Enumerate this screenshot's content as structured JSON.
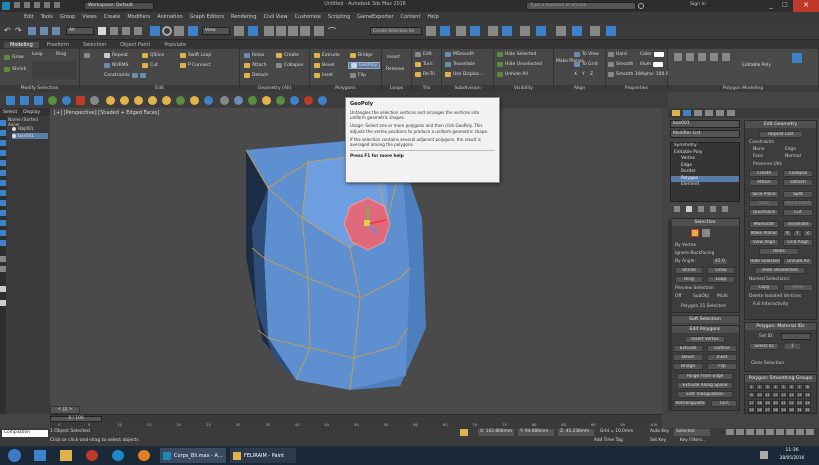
{
  "titlebar": {
    "workspace": "Workspace: Default",
    "title": "Untitled - Autodesk 3ds Max 2016",
    "search_placeholder": "Type a keyword or phrase",
    "sign_in": "Sign In"
  },
  "menu": [
    "Edit",
    "Tools",
    "Group",
    "Views",
    "Create",
    "Modifiers",
    "Animation",
    "Graph Editors",
    "Rendering",
    "Civil View",
    "Customize",
    "Scripting",
    "GameExporter",
    "Content",
    "Help"
  ],
  "toolbar": {
    "filter": "All",
    "view": "View",
    "selection_set": "Create Selection Se"
  },
  "ribbon_tabs": [
    {
      "label": "Modeling",
      "active": true
    },
    {
      "label": "Freeform",
      "active": false
    },
    {
      "label": "Selection",
      "active": false
    },
    {
      "label": "Object Paint",
      "active": false
    },
    {
      "label": "Populate",
      "active": false
    }
  ],
  "ribbon": {
    "polygon_modeling": {
      "title": "Polygon Modeling",
      "buttons": [
        "Grow",
        "Shrink"
      ],
      "loop": "Loop",
      "ring": "Ring",
      "modify_selection": "Modify Selection"
    },
    "edit": {
      "title": "Edit",
      "buttons": [
        "Repeat",
        "QSlice",
        "Swift Loop",
        "NURMS",
        "Cut",
        "P Connect",
        "Constraints"
      ]
    },
    "geometry": {
      "title": "Geometry (All)",
      "buttons": [
        "Relax",
        "Create",
        "Attach",
        "Collapse",
        "Detach"
      ]
    },
    "polygons": {
      "title": "Polygons",
      "buttons": [
        "Extrude",
        "Bridge",
        "Bevel",
        "GeoPoly",
        "Inset",
        "Flip"
      ]
    },
    "loops": {
      "title": "Loops",
      "buttons": [
        "Insert",
        "Remove"
      ]
    },
    "tris": {
      "title": "Tris",
      "buttons": [
        "Edit",
        "Turn",
        "Re-Tri"
      ]
    },
    "subdivision": {
      "title": "Subdivision",
      "buttons": [
        "MSmooth",
        "Tessellate",
        "Use Displac..."
      ]
    },
    "visibility": {
      "title": "Visibility",
      "buttons": [
        "Hide Selected",
        "Hide Unselected",
        "Unhide All"
      ]
    },
    "align": {
      "title": "Align",
      "buttons": [
        "Make Planar",
        "To View",
        "To Grid",
        "X",
        "Y",
        "Z"
      ]
    },
    "properties": {
      "title": "Properties",
      "buttons": [
        "Hard",
        "Smooth",
        "Smooth 30",
        "Color",
        "Illum",
        "Alpha: 100.00"
      ]
    },
    "editable_poly": "Editable Poly"
  },
  "left_panel": {
    "tabs": [
      "Select",
      "Display"
    ],
    "header": "Name (Sorted Ascer",
    "items": [
      "Obj001",
      "box001"
    ]
  },
  "viewport": {
    "label": "[+] [Perspective] [Shaded + Edged Faces]"
  },
  "tooltip": {
    "title": "GeoPoly",
    "p1": "Untangles the selection vertices and arranges the vertices into uniform geometric shapes.",
    "p2": "Usage: Select one or more polygons and then click GeoPoly. This adjusts the vertex positions to produce a uniform geometric shape.",
    "p3": "If the selection contains several adjacent polygons, the result is averaged among the polygons.",
    "footer": "Press F1 for more help"
  },
  "command_panel": {
    "object_name": "box001",
    "modifier_list": "Modifier List",
    "stack": [
      "Symmetry",
      "Editable Poly",
      "Vertex",
      "Edge",
      "Border",
      "Polygon",
      "Element"
    ],
    "selection": {
      "title": "Selection",
      "by_vertex": "By Vertex",
      "ignore_backfacing": "Ignore Backfacing",
      "by_angle": "By Angle:",
      "angle": "45.0",
      "shrink": "Shrink",
      "grow": "Grow",
      "ring": "Ring",
      "loop": "Loop",
      "preview_selection": "Preview Selection",
      "preview_opts": [
        "Off",
        "SubObj",
        "Multi"
      ],
      "status": "Polygon 21 Selected"
    },
    "soft_selection": "Soft Selection",
    "edit_polygons": {
      "title": "Edit Polygons",
      "insert_vertex": "Insert Vertex",
      "rows": [
        [
          "Extrude",
          "Outline"
        ],
        [
          "Bevel",
          "Inset"
        ],
        [
          "Bridge",
          "Flip"
        ]
      ],
      "hinge": "Hinge From Edge",
      "extrude_spline": "Extrude Along Spline",
      "edit_tri": "Edit Triangulation",
      "retri": "Retriangulate",
      "turn": "Turn"
    },
    "edit_geometry": {
      "title": "Edit Geometry",
      "repeat_last": "Repeat Last",
      "constraints": "Constraints",
      "cons_opts": [
        "None",
        "Edge",
        "Face",
        "Normal"
      ],
      "preserve_uvs": "Preserve UVs",
      "create": "Create",
      "collapse": "Collapse",
      "attach": "Attach",
      "detach": "Detach",
      "slice_plane": "Slice Plane",
      "split": "Split",
      "slice": "Slice",
      "reset_plane": "Reset Plane",
      "quickslice": "QuickSlice",
      "cut": "Cut",
      "msmooth": "MSmooth",
      "tessellate": "Tessellate",
      "make_planar": "Make Planar",
      "xyz": [
        "X",
        "Y",
        "Z"
      ],
      "view_align": "View Align",
      "grid_align": "Grid Align",
      "relax": "Relax",
      "hide_selected": "Hide Selected",
      "unhide_all": "Unhide All",
      "hide_unselected": "Hide Unselected",
      "named_selections": "Named Selections:",
      "copy": "Copy",
      "paste": "Paste",
      "delete_isolated": "Delete Isolated Vertices",
      "full_interactivity": "Full Interactivity"
    },
    "material_ids": {
      "title": "Polygon: Material IDs",
      "set_id": "Set ID:",
      "select_id": "Select ID",
      "select_val": "1",
      "clear_selection": "Clear Selection"
    },
    "smoothing": {
      "title": "Polygon: Smoothing Groups",
      "groups": [
        "1",
        "2",
        "3",
        "4",
        "5",
        "6",
        "7",
        "8",
        "9",
        "10",
        "11",
        "12",
        "13",
        "14",
        "15",
        "16",
        "17",
        "18",
        "19",
        "20",
        "21",
        "22",
        "23",
        "24",
        "25",
        "26",
        "27",
        "28",
        "29",
        "30",
        "31",
        "32"
      ]
    }
  },
  "timeline": {
    "frame": "0 / 100",
    "ticks": [
      "0",
      "5",
      "10",
      "15",
      "20",
      "25",
      "30",
      "35",
      "40",
      "45",
      "50",
      "55",
      "60",
      "65",
      "70",
      "75",
      "80",
      "85",
      "90",
      "95",
      "100"
    ]
  },
  "status": {
    "maxscript": "Compilation",
    "selected": "1 Object Selected",
    "prompt": "Click or click-and-drag to select objects",
    "x": "X: 102.866mm",
    "y": "Y: 94.686mm",
    "z": "Z: 45.238mm",
    "grid": "Grid = 10.0mm",
    "add_time_tag": "Add Time Tag",
    "auto_key": "Auto Key",
    "selected_mode": "Selected",
    "set_key": "Set Key",
    "key_filters": "Key Filters..."
  },
  "taskbar": {
    "items": [
      "Corps_Bli.max - A...",
      "FELIRAIM - Paint"
    ],
    "time": "11:36",
    "date": "28/05/2016"
  }
}
